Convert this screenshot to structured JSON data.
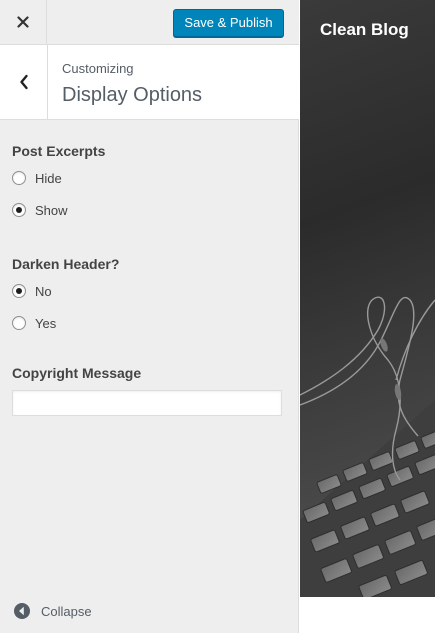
{
  "topbar": {
    "close_icon": "close-icon",
    "publish_label": "Save & Publish",
    "publish_color": "#0085ba"
  },
  "section": {
    "breadcrumb": "Customizing",
    "title": "Display Options",
    "back_icon": "chevron-left-icon"
  },
  "controls": {
    "post_excerpts": {
      "title": "Post Excerpts",
      "options": [
        {
          "label": "Hide",
          "checked": false
        },
        {
          "label": "Show",
          "checked": true
        }
      ]
    },
    "darken_header": {
      "title": "Darken Header?",
      "options": [
        {
          "label": "No",
          "checked": true
        },
        {
          "label": "Yes",
          "checked": false
        }
      ]
    },
    "copyright": {
      "title": "Copyright Message",
      "value": ""
    }
  },
  "footer": {
    "collapse_label": "Collapse",
    "collapse_icon": "collapse-arrow-icon"
  },
  "preview": {
    "site_title": "Clean Blog"
  }
}
